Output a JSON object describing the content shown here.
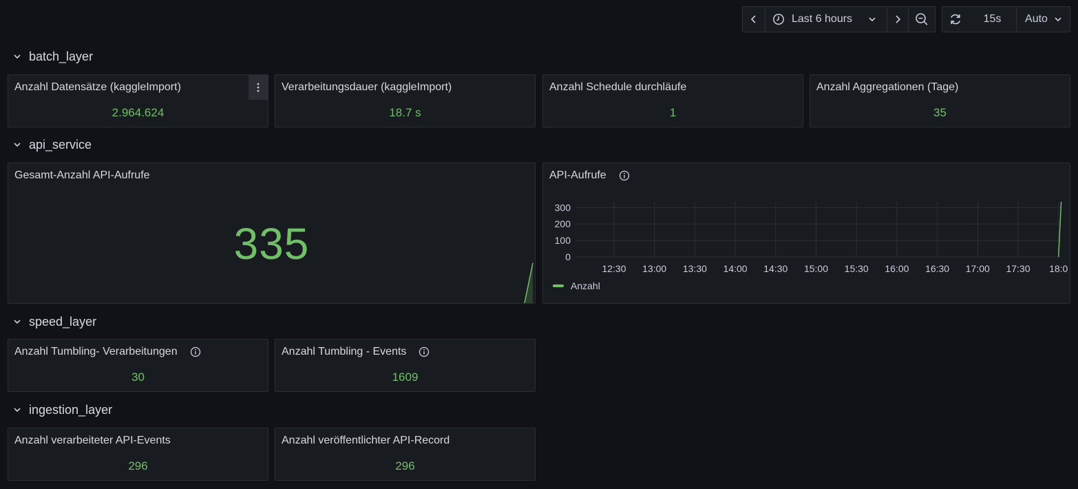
{
  "toolbar": {
    "time_range": "Last 6 hours",
    "refresh_interval": "15s",
    "auto_label": "Auto"
  },
  "rows": {
    "batch_layer": "batch_layer",
    "api_service": "api_service",
    "speed_layer": "speed_layer",
    "ingestion_layer": "ingestion_layer"
  },
  "panels": {
    "datensaetze": {
      "title": "Anzahl Datensätze (kaggleImport)",
      "value": "2.964.624"
    },
    "verarbeitungsdauer": {
      "title": "Verarbeitungsdauer (kaggleImport)",
      "value": "18.7 s"
    },
    "schedule": {
      "title": "Anzahl Schedule durchläufe",
      "value": "1"
    },
    "aggregationen": {
      "title": "Anzahl Aggregationen (Tage)",
      "value": "35"
    },
    "gesamt_api": {
      "title": "Gesamt-Anzahl API-Aufrufe",
      "value": "335"
    },
    "api_aufrufe": {
      "title": "API-Aufrufe"
    },
    "tumbling_verarbeitungen": {
      "title": "Anzahl Tumbling- Verarbeitungen",
      "value": "30"
    },
    "tumbling_events": {
      "title": "Anzahl Tumbling - Events",
      "value": "1609"
    },
    "verarbeiteter_events": {
      "title": "Anzahl verarbeiteter API-Events",
      "value": "296"
    },
    "veroeffentlichter_record": {
      "title": "Anzahl veröffentlichter API-Record",
      "value": "296"
    }
  },
  "chart_data": {
    "type": "line",
    "title": "API-Aufrufe",
    "x_ticks": [
      "12:30",
      "13:00",
      "13:30",
      "14:00",
      "14:30",
      "15:00",
      "15:30",
      "16:00",
      "16:30",
      "17:00",
      "17:30",
      "18:0"
    ],
    "y_ticks": [
      "0",
      "100",
      "200",
      "300"
    ],
    "ylim": [
      0,
      335
    ],
    "grid": true,
    "legend_placement": "bottom-left",
    "series": [
      {
        "name": "Anzahl",
        "color": "#73bf69",
        "x": [
          "18:00",
          "18:02"
        ],
        "y": [
          0,
          335
        ]
      }
    ]
  },
  "colors": {
    "value_green": "#73bf69",
    "background": "#111217",
    "panel": "#181b1f"
  }
}
